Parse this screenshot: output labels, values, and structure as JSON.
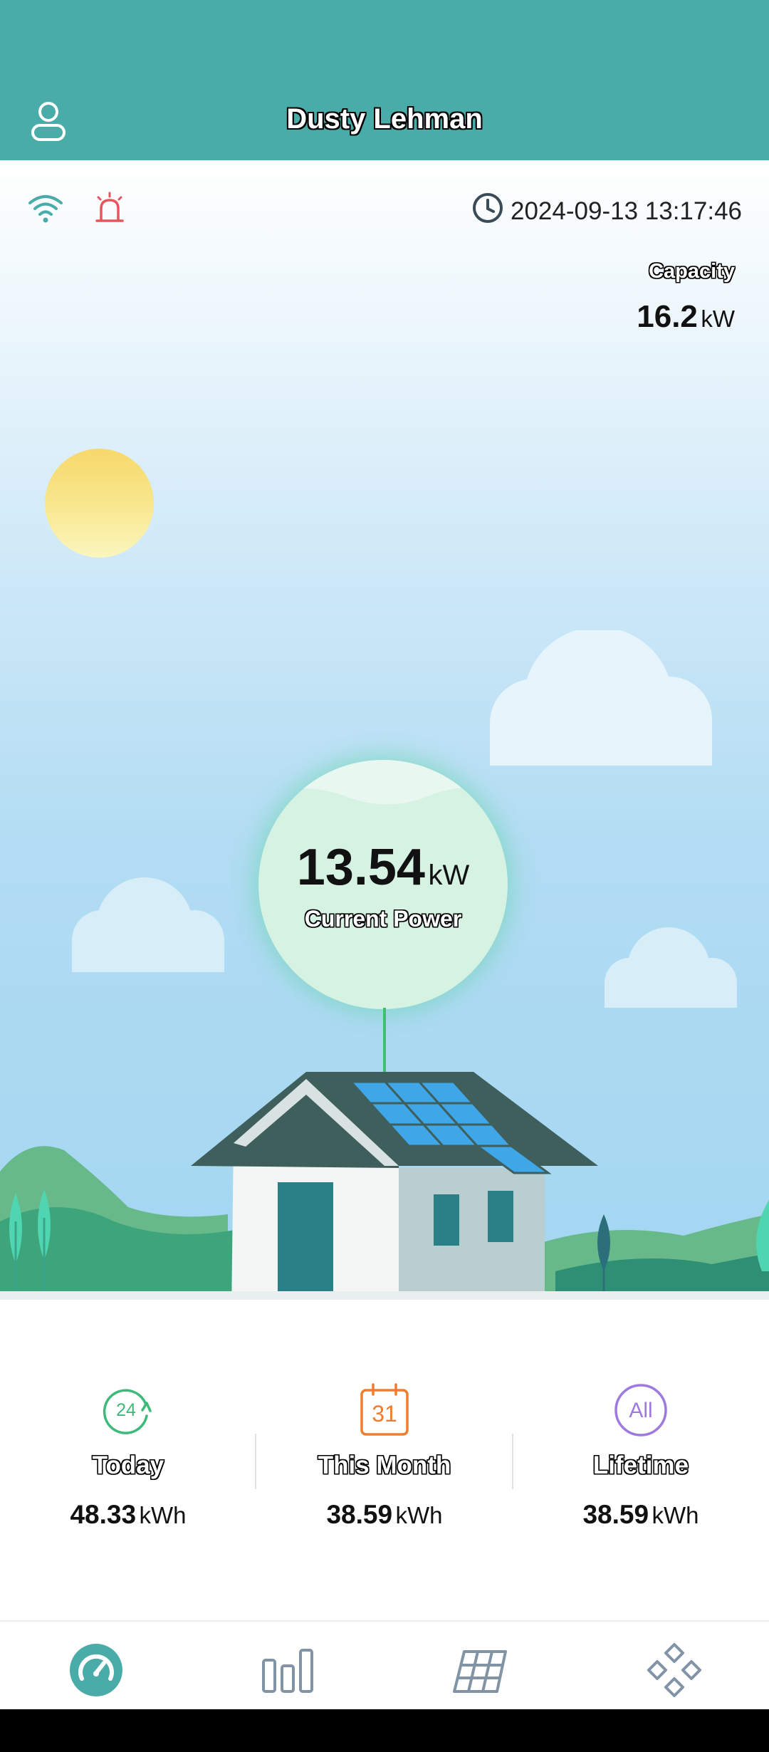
{
  "header": {
    "title": "Dusty Lehman",
    "user_icon": "user-icon"
  },
  "status": {
    "wifi_icon": "wifi-icon",
    "alarm_icon": "alarm-icon",
    "clock_icon": "clock-icon",
    "datetime": "2024-09-13 13:17:46"
  },
  "capacity": {
    "label": "Capacity",
    "value": "16.2",
    "unit": "kW"
  },
  "current_power": {
    "value": "13.54",
    "unit": "kW",
    "label": "Current Power"
  },
  "stats": [
    {
      "label": "Today",
      "value": "48.33",
      "unit": "kWh",
      "icon_text": "24",
      "icon": "today-icon"
    },
    {
      "label": "This Month",
      "value": "38.59",
      "unit": "kWh",
      "icon_text": "31",
      "icon": "calendar-icon"
    },
    {
      "label": "Lifetime",
      "value": "38.59",
      "unit": "kWh",
      "icon_text": "All",
      "icon": "all-icon"
    }
  ],
  "nav": [
    {
      "icon": "dashboard-icon",
      "active": true
    },
    {
      "icon": "bar-chart-icon",
      "active": false
    },
    {
      "icon": "solar-panel-icon",
      "active": false
    },
    {
      "icon": "devices-icon",
      "active": false
    }
  ],
  "colors": {
    "header": "#4aaca8",
    "accent": "#4aaca8",
    "alarm": "#e8555d",
    "today": "#3dba7a",
    "month": "#ef7d2d",
    "lifetime": "#9d79e0"
  }
}
